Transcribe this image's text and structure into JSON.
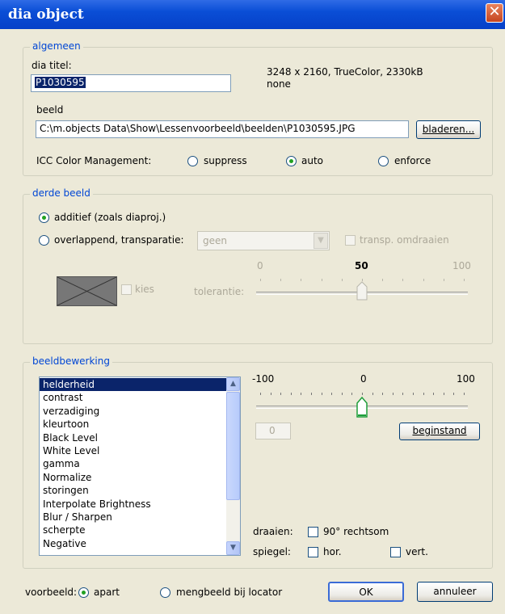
{
  "window": {
    "title": "dia object",
    "close_glyph": "✕"
  },
  "algemeen": {
    "legend": "algemeen",
    "title_label": "dia titel:",
    "title_value": "P1030595",
    "info_line1": "3248 x 2160, TrueColor, 2330kB",
    "info_line2": "none",
    "beeld_label": "beeld",
    "path_value": "C:\\m.objects Data\\Show\\Lessenvoorbeeld\\beelden\\P1030595.JPG",
    "browse_label": "bladeren...",
    "icc_label": "ICC Color Management:",
    "icc_options": [
      "suppress",
      "auto",
      "enforce"
    ],
    "icc_selected": "auto"
  },
  "derde_beeld": {
    "legend": "derde beeld",
    "option_additief": "additief (zoals diaproj.)",
    "option_overlappend": "overlappend, transparatie:",
    "selected": "additief",
    "combo_value": "geen",
    "transp_label": "transp. omdraaien",
    "kies_label": "kies",
    "tolerance_label": "tolerantie:",
    "scale": [
      "0",
      "50",
      "100"
    ],
    "tolerance_value": 50
  },
  "beeldbewerking": {
    "legend": "beeldbewerking",
    "items": [
      "helderheid",
      "contrast",
      "verzadiging",
      "kleurtoon",
      "Black Level",
      "White Level",
      "gamma",
      "Normalize",
      "storingen",
      "Interpolate Brightness",
      "Blur / Sharpen",
      "scherpte",
      "Negative"
    ],
    "selected_index": 0,
    "scale": [
      "-100",
      "0",
      "100"
    ],
    "slider_value": 0,
    "value_box": "0",
    "reset_label": "beginstand",
    "rotate_label": "draaien:",
    "rotate_option": "90° rechtsom",
    "mirror_label": "spiegel:",
    "mirror_hor": "hor.",
    "mirror_vert": "vert."
  },
  "footer": {
    "preview_label": "voorbeeld:",
    "option_apart": "apart",
    "option_meng": "mengbeeld bij locator",
    "preview_selected": "apart",
    "ok_label": "OK",
    "cancel_label": "annuleer"
  },
  "icons": {
    "close": "close-icon",
    "dropdown": "chevron-down-icon",
    "scroll_up": "scroll-up-icon",
    "scroll_down": "scroll-down-icon"
  }
}
